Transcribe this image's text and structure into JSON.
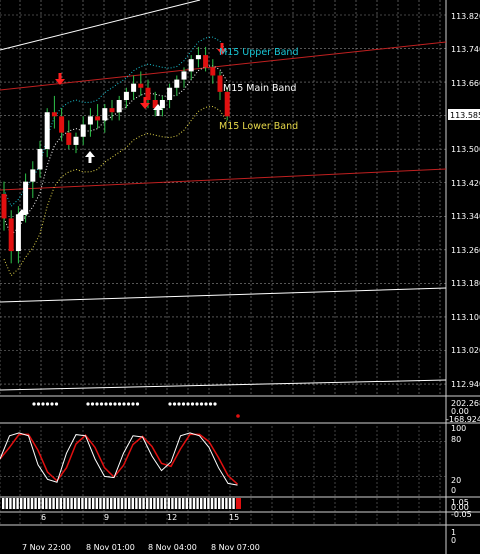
{
  "colors": {
    "background": "#000000",
    "grid": "#8a8a8a",
    "bull": "#ffffff",
    "bear": "#e11010",
    "arrow_bull": "#ffffff",
    "arrow_bear": "#ff2020",
    "band_upper": "#19c7d6",
    "band_main": "#ffffff",
    "band_lower": "#e6d84a",
    "stoch_main": "#ffffff",
    "stoch_signal": "#e11010",
    "trend_line": "#c02020",
    "channel_line": "#ffffff",
    "current_price_box": "#ffffff"
  },
  "main_chart": {
    "price_labels": [
      "113.820",
      "113.740",
      "113.660",
      "113.585",
      "113.500",
      "113.420",
      "113.340",
      "113.260",
      "113.180",
      "113.100",
      "113.020",
      "112.940"
    ],
    "current_price": "113.585",
    "band_labels": {
      "upper": "M15 Upper Band",
      "main": "M15 Main Band",
      "lower": "M15 Lower Band"
    }
  },
  "indicator1": {
    "labels": [
      "202.268",
      "0.00",
      "-168.924"
    ]
  },
  "stochastic": {
    "labels": [
      "100",
      "80",
      "20",
      "0"
    ]
  },
  "indicator3": {
    "labels": [
      "1.05",
      "0.00",
      "-0.05"
    ]
  },
  "indicator4": {
    "labels": [
      "1",
      "0"
    ]
  },
  "sub_axis": {
    "labels": [
      "6",
      "9",
      "12",
      "15"
    ]
  },
  "time_axis": {
    "labels": [
      "7 Nov 22:00",
      "8 Nov 01:00",
      "8 Nov 04:00",
      "8 Nov 07:00"
    ]
  },
  "chart_data": {
    "type": "candlestick",
    "y_range": [
      112.9,
      113.86
    ],
    "candles": [
      {
        "o": 113.39,
        "h": 113.42,
        "l": 113.3,
        "c": 113.33
      },
      {
        "o": 113.33,
        "h": 113.35,
        "l": 113.22,
        "c": 113.25
      },
      {
        "o": 113.25,
        "h": 113.36,
        "l": 113.22,
        "c": 113.34
      },
      {
        "o": 113.34,
        "h": 113.44,
        "l": 113.32,
        "c": 113.42
      },
      {
        "o": 113.42,
        "h": 113.47,
        "l": 113.38,
        "c": 113.45
      },
      {
        "o": 113.45,
        "h": 113.52,
        "l": 113.43,
        "c": 113.5
      },
      {
        "o": 113.5,
        "h": 113.6,
        "l": 113.48,
        "c": 113.59
      },
      {
        "o": 113.59,
        "h": 113.63,
        "l": 113.55,
        "c": 113.58
      },
      {
        "o": 113.58,
        "h": 113.6,
        "l": 113.52,
        "c": 113.54
      },
      {
        "o": 113.54,
        "h": 113.57,
        "l": 113.5,
        "c": 113.51
      },
      {
        "o": 113.51,
        "h": 113.54,
        "l": 113.49,
        "c": 113.53
      },
      {
        "o": 113.53,
        "h": 113.58,
        "l": 113.51,
        "c": 113.56
      },
      {
        "o": 113.56,
        "h": 113.6,
        "l": 113.53,
        "c": 113.58
      },
      {
        "o": 113.58,
        "h": 113.61,
        "l": 113.55,
        "c": 113.57
      },
      {
        "o": 113.57,
        "h": 113.61,
        "l": 113.54,
        "c": 113.6
      },
      {
        "o": 113.6,
        "h": 113.62,
        "l": 113.57,
        "c": 113.59
      },
      {
        "o": 113.59,
        "h": 113.63,
        "l": 113.57,
        "c": 113.62
      },
      {
        "o": 113.62,
        "h": 113.65,
        "l": 113.6,
        "c": 113.64
      },
      {
        "o": 113.64,
        "h": 113.68,
        "l": 113.62,
        "c": 113.66
      },
      {
        "o": 113.66,
        "h": 113.69,
        "l": 113.63,
        "c": 113.65
      },
      {
        "o": 113.65,
        "h": 113.67,
        "l": 113.6,
        "c": 113.62
      },
      {
        "o": 113.62,
        "h": 113.64,
        "l": 113.58,
        "c": 113.6
      },
      {
        "o": 113.6,
        "h": 113.63,
        "l": 113.58,
        "c": 113.62
      },
      {
        "o": 113.62,
        "h": 113.66,
        "l": 113.6,
        "c": 113.65
      },
      {
        "o": 113.65,
        "h": 113.68,
        "l": 113.63,
        "c": 113.67
      },
      {
        "o": 113.67,
        "h": 113.7,
        "l": 113.65,
        "c": 113.69
      },
      {
        "o": 113.69,
        "h": 113.73,
        "l": 113.67,
        "c": 113.72
      },
      {
        "o": 113.72,
        "h": 113.75,
        "l": 113.7,
        "c": 113.73
      },
      {
        "o": 113.73,
        "h": 113.75,
        "l": 113.69,
        "c": 113.7
      },
      {
        "o": 113.7,
        "h": 113.72,
        "l": 113.66,
        "c": 113.68
      },
      {
        "o": 113.68,
        "h": 113.69,
        "l": 113.62,
        "c": 113.64
      },
      {
        "o": 113.64,
        "h": 113.65,
        "l": 113.57,
        "c": 113.58
      }
    ]
  }
}
